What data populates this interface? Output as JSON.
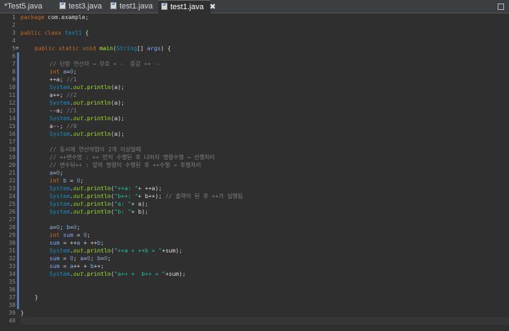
{
  "tabs": [
    {
      "label": "*Test5.java"
    },
    {
      "label": "test3.java"
    },
    {
      "label": "test1.java"
    },
    {
      "label": "test1.java",
      "active": true
    }
  ],
  "line_numbers": [
    "1",
    "2",
    "3",
    "4",
    "5",
    "6",
    "7",
    "8",
    "9",
    "10",
    "11",
    "12",
    "13",
    "14",
    "15",
    "16",
    "17",
    "18",
    "19",
    "20",
    "21",
    "22",
    "23",
    "24",
    "25",
    "26",
    "27",
    "28",
    "29",
    "30",
    "31",
    "32",
    "33",
    "34",
    "35",
    "36",
    "37",
    "38",
    "39",
    "40"
  ],
  "code": {
    "l1": [
      "package",
      " com.example;"
    ],
    "l3": [
      "public",
      " ",
      "class",
      " ",
      "test1",
      " {"
    ],
    "l5": [
      "public",
      " ",
      "static",
      " ",
      "void",
      " ",
      "main",
      "(",
      "String",
      "[] ",
      "args",
      ") {"
    ],
    "l7": "// 단항 연산자 → 부호 + -  증감 ++ --",
    "l8": [
      "int",
      " ",
      "a",
      "=",
      "0",
      ";"
    ],
    "l9": [
      "++a; ",
      "//1"
    ],
    "l10": [
      "System",
      ".",
      "out",
      ".",
      "println",
      "(a);"
    ],
    "l11": [
      "a++; ",
      "//2"
    ],
    "l12": [
      "System",
      ".",
      "out",
      ".",
      "println",
      "(a);"
    ],
    "l13": [
      "--a; ",
      "//1"
    ],
    "l14": [
      "System",
      ".",
      "out",
      ".",
      "println",
      "(a);"
    ],
    "l15": [
      "a--; ",
      "//0"
    ],
    "l16": [
      "System",
      ".",
      "out",
      ".",
      "println",
      "(a);"
    ],
    "l18": "// 동시에 연산작업이 2개 이상일때",
    "l19": "// ++변수명 : ++ 먼저 수행된 후 나머지 명령수행 → 선행처리",
    "l20": "// 변수뒤++ : 앞의 명령이 수행된 후 ++수행 → 후행처리",
    "l21": [
      "a",
      "=",
      "0",
      ";"
    ],
    "l22": [
      "int",
      " ",
      "b",
      " = ",
      "0",
      ";"
    ],
    "l23": [
      "System",
      ".",
      "out",
      ".",
      "println",
      "(",
      "\"++a: \"",
      "+ ++a);"
    ],
    "l24": [
      "System",
      ".",
      "out",
      ".",
      "println",
      "(",
      "\"b++: \"",
      "+ b++); ",
      "// 출력이 된 후 ++가 실행됨"
    ],
    "l25": [
      "System",
      ".",
      "out",
      ".",
      "println",
      "(",
      "\"a: \"",
      "+ a);"
    ],
    "l26": [
      "System",
      ".",
      "out",
      ".",
      "println",
      "(",
      "\"b: \"",
      "+ b);"
    ],
    "l28": [
      "a",
      "=",
      "0",
      "; ",
      "b",
      "=",
      "0",
      ";"
    ],
    "l29": [
      "int",
      " ",
      "sum",
      " = ",
      "0",
      ";"
    ],
    "l30": [
      "sum",
      " = ++",
      "a",
      " + ++",
      "b",
      ";"
    ],
    "l31": [
      "System",
      ".",
      "out",
      ".",
      "println",
      "(",
      "\"++a + ++b = \"",
      "+sum);"
    ],
    "l32": [
      "sum",
      " = ",
      "0",
      "; ",
      "a",
      "=",
      "0",
      "; ",
      "b",
      "=",
      "0",
      ";"
    ],
    "l33": [
      "sum",
      " = ",
      "a",
      "++ + ",
      "b",
      "++;"
    ],
    "l34": [
      "System",
      ".",
      "out",
      ".",
      "println",
      "(",
      "\"a++ +  b++ = \"",
      "+sum);"
    ],
    "l37": "}",
    "l39": "}"
  }
}
